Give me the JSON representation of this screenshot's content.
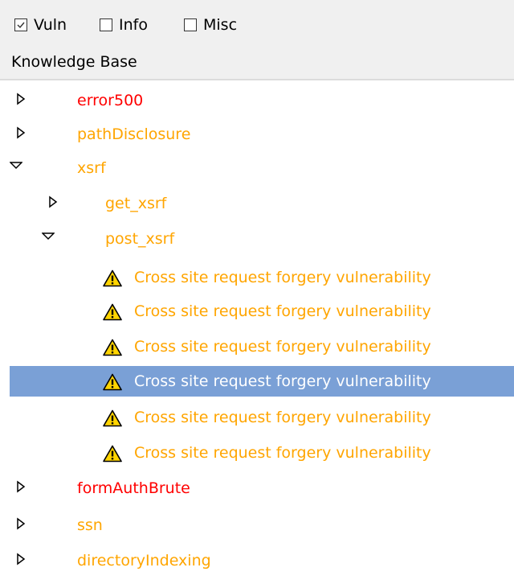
{
  "filters": [
    {
      "label": "Vuln",
      "checked": true
    },
    {
      "label": "Info",
      "checked": false
    },
    {
      "label": "Misc",
      "checked": false
    }
  ],
  "header": {
    "title": "Knowledge Base"
  },
  "tree": {
    "error500": "error500",
    "pathDisclosure": "pathDisclosure",
    "xsrf": "xsrf",
    "get_xsrf": "get_xsrf",
    "post_xsrf": "post_xsrf",
    "vulns": [
      "Cross site request forgery vulnerability",
      "Cross site request forgery vulnerability",
      "Cross site request forgery vulnerability",
      "Cross site request forgery vulnerability",
      "Cross site request forgery vulnerability",
      "Cross site request forgery vulnerability"
    ],
    "formAuthBrute": "formAuthBrute",
    "ssn": "ssn",
    "directoryIndexing": "directoryIndexing"
  },
  "colors": {
    "severity_high": "#ff0000",
    "severity_medium": "#ffa500",
    "selection": "#7aa0d6"
  }
}
